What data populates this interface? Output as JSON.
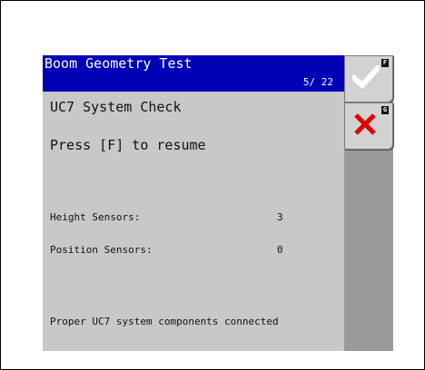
{
  "header": {
    "title": "Boom Geometry Test",
    "page": "5/ 22"
  },
  "main": {
    "heading": "UC7 System Check",
    "instruction": "Press [F] to resume",
    "rows": [
      {
        "label": "Height Sensors:",
        "value": "3"
      },
      {
        "label": "Position Sensors:",
        "value": "0"
      }
    ],
    "status": "Proper UC7 system components connected"
  },
  "softkeys": {
    "f": {
      "key": "F",
      "icon": "check-icon",
      "color": "#ffffff"
    },
    "g": {
      "key": "G",
      "icon": "close-icon",
      "color": "#e00000"
    }
  }
}
